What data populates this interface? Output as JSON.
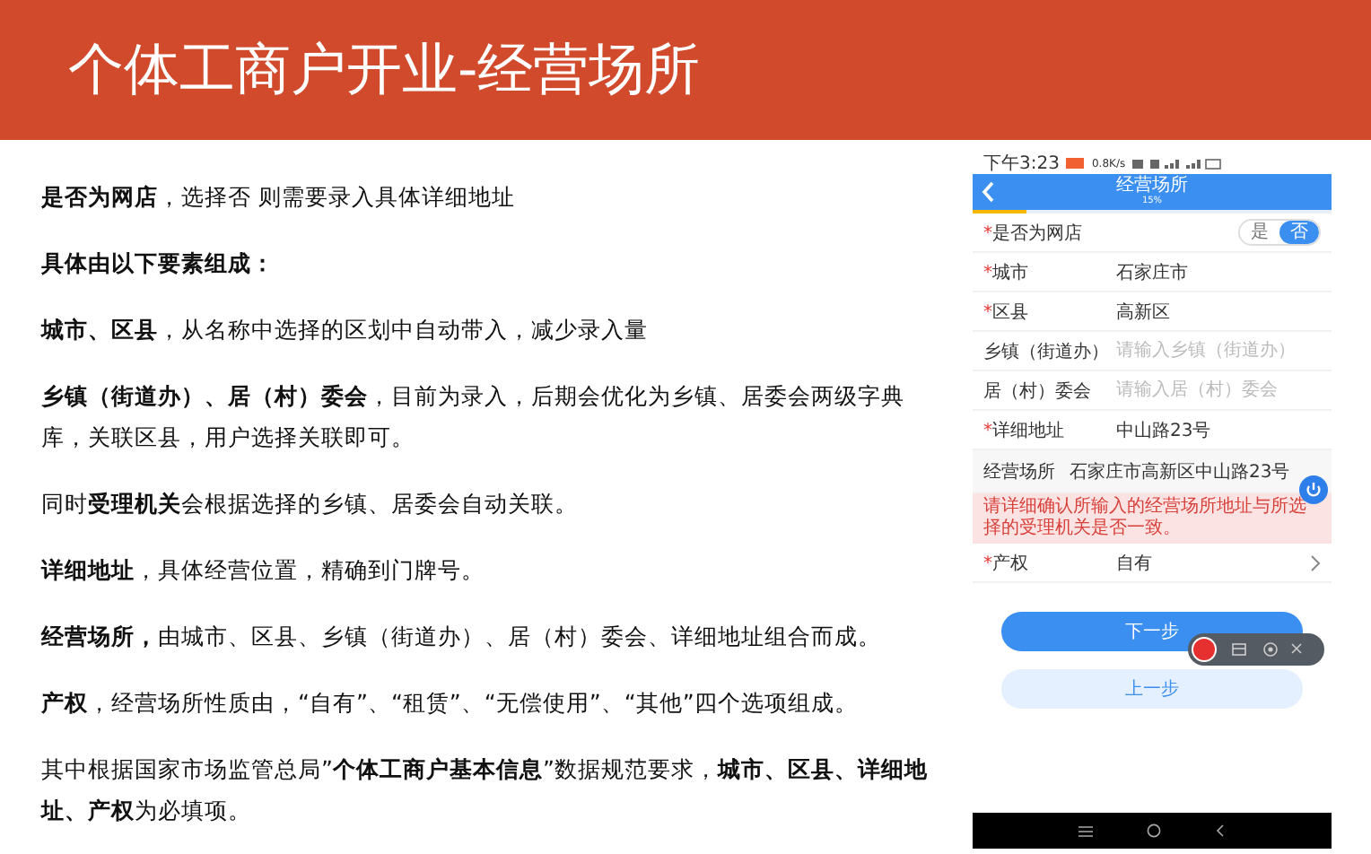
{
  "header": {
    "title": "个体工商户开业-经营场所"
  },
  "paragraphs": [
    "**是否为网店**，选择否 则需要录入具体详细地址",
    "**具体由以下要素组成：**",
    "**城市、区县**，从名称中选择的区划中自动带入，减少录入量",
    "**乡镇（街道办）、居（村）委会**，目前为录入，后期会优化为乡镇、居委会两级字典库，关联区县，用户选择关联即可。",
    "同时**受理机关**会根据选择的乡镇、居委会自动关联。",
    "**详细地址**，具体经营位置，精确到门牌号。",
    "**经营场所，**由城市、区县、乡镇（街道办）、居（村）委会、详细地址组合而成。",
    "**产权**，经营场所性质由，“自有”、“租赁”、“无偿使用”、“其他”四个选项组成。",
    "其中根据国家市场监管总局”**个体工商户基本信息**”数据规范要求，**城市、区县、详细地址、产权**为必填项。"
  ],
  "phone": {
    "required_mark": "*",
    "status_bar": {
      "time": "下午3:23",
      "speed": "0.8K/s"
    },
    "nav": {
      "title": "经营场所",
      "progress_text": "15%",
      "level": 0.15
    },
    "rows": [
      {
        "kind": "toggle",
        "label": "是否为网店",
        "required": true,
        "options": [
          {
            "label": "是",
            "selected": false
          },
          {
            "label": "否",
            "selected": true
          }
        ]
      },
      {
        "kind": "text",
        "label": "城市",
        "required": true,
        "value": "石家庄市"
      },
      {
        "kind": "text",
        "label": "区县",
        "required": true,
        "value": "高新区"
      },
      {
        "kind": "input",
        "label": "乡镇（街道办）",
        "required": false,
        "placeholder": "请输入乡镇（街道办）"
      },
      {
        "kind": "input",
        "label": "居（村）委会",
        "required": false,
        "placeholder": "请输入居（村）委会"
      },
      {
        "kind": "text",
        "label": "详细地址",
        "required": true,
        "value": "中山路23号"
      },
      {
        "kind": "summary",
        "label": "经营场所",
        "required": false,
        "value": "石家庄市高新区中山路23号"
      },
      {
        "kind": "warning",
        "text": "请详细确认所输入的经营场所地址与所选择的受理机关是否一致。"
      },
      {
        "kind": "select",
        "label": "产权",
        "required": true,
        "value": "自有"
      }
    ],
    "buttons": [
      {
        "label": "下一步",
        "kind": "primary"
      },
      {
        "label": "上一步",
        "kind": "secondary"
      }
    ]
  }
}
